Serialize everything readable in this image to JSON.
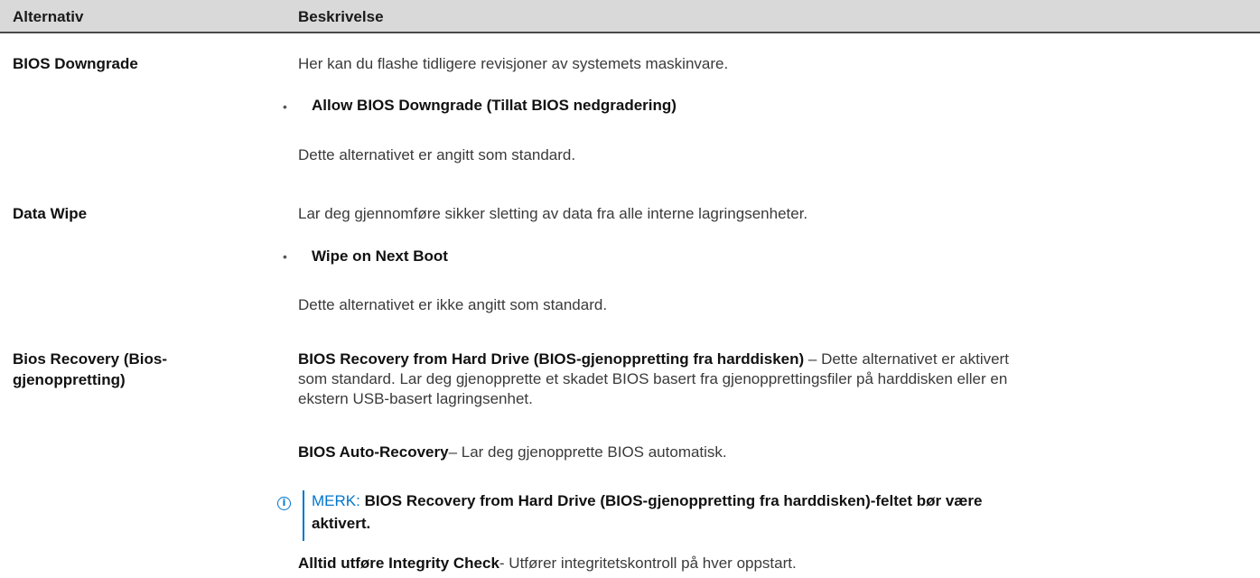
{
  "table": {
    "headers": [
      "Alternativ",
      "Beskrivelse"
    ],
    "rows": [
      {
        "option": "BIOS Downgrade",
        "description": "Her kan du flashe tidligere revisjoner av systemets maskinvare.",
        "bullet": "Allow BIOS Downgrade (Tillat BIOS nedgradering)",
        "note": "Dette alternativet er angitt som standard."
      },
      {
        "option": "Data Wipe",
        "description": "Lar deg gjennomføre sikker sletting av data fra alle interne lagringsenheter.",
        "bullet": "Wipe on Next Boot",
        "note": "Dette alternativet er ikke angitt som standard."
      },
      {
        "option_line1": "Bios Recovery (Bios-",
        "option_line2": "gjenoppretting)",
        "p1_bold": "BIOS Recovery from Hard Drive (BIOS-gjenoppretting fra harddisken)",
        "p1_line1_rest": " – Dette alternativet er aktivert",
        "p1_line2": "som standard. Lar deg gjenopprette et skadet BIOS basert fra gjenopprettingsfiler på harddisken eller en",
        "p1_line3": "ekstern USB-basert lagringsenhet.",
        "p2_bold": "BIOS Auto-Recovery",
        "p2_rest": "– Lar deg gjenopprette BIOS automatisk.",
        "note_label": "MERK:",
        "note_line1": " BIOS Recovery from Hard Drive (BIOS-gjenoppretting fra harddisken)-feltet bør være",
        "note_line2": "aktivert.",
        "p3_bold": "Alltid utføre Integrity Check",
        "p3_rest": "- Utfører integritetskontroll på hver oppstart."
      }
    ]
  },
  "icons": {
    "bullet": "•",
    "info": "i"
  },
  "colors": {
    "accent": "#0076ce",
    "header_bg": "#d9d9d9"
  }
}
